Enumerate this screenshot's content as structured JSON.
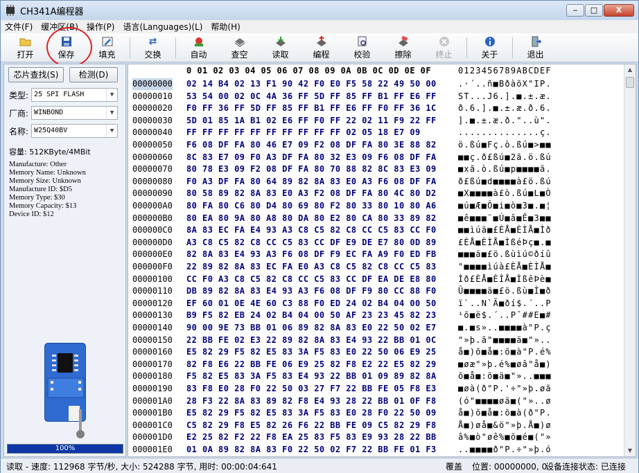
{
  "window": {
    "title": "CH341A编程器",
    "min_label": "‒",
    "max_label": "□",
    "close_label": "X"
  },
  "menu": [
    "文件(F)",
    "缓冲区(B)",
    "操作(P)",
    "语言(Languages)(L)",
    "帮助(H)"
  ],
  "toolbar": [
    {
      "label": "打开",
      "icon": "open-icon"
    },
    {
      "label": "保存",
      "icon": "save-icon"
    },
    {
      "label": "填充",
      "icon": "fill-icon"
    },
    {
      "label": "交换",
      "icon": "swap-icon"
    },
    {
      "label": "自动",
      "icon": "auto-icon"
    },
    {
      "label": "查空",
      "icon": "blank-check-icon"
    },
    {
      "label": "读取",
      "icon": "read-icon"
    },
    {
      "label": "编程",
      "icon": "program-icon"
    },
    {
      "label": "校验",
      "icon": "verify-icon"
    },
    {
      "label": "擦除",
      "icon": "erase-icon"
    },
    {
      "label": "终止",
      "icon": "stop-icon"
    },
    {
      "label": "关于",
      "icon": "about-icon"
    },
    {
      "label": "退出",
      "icon": "exit-icon"
    }
  ],
  "left": {
    "chip_find_btn": "芯片查找(S)",
    "detect_btn": "检测(D)",
    "type_label": "类型:",
    "type_value": "25 SPI FLASH",
    "vendor_label": "厂商:",
    "vendor_value": "WINBOND",
    "name_label": "名称:",
    "name_value": "W25Q40BV",
    "capacity": "容量: 512KByte/4MBit",
    "info_lines": [
      "Manufacture: Other",
      "Memory Name: Unknown",
      "Memory Size: Unknown",
      "Manufacture ID: $D5",
      "Memory Type: $30",
      "Memory Capacity: $13",
      "Device ID: $12"
    ],
    "progress_text": "100%",
    "progress_value": 1.0
  },
  "hex": {
    "header_cols": "0 01 02 03 04 05 06 07 08 09 0A 0B 0C 0D 0E 0F",
    "header_ascii": "0123456789ABCDEF",
    "rows": [
      {
        "addr": "00000000",
        "bytes": "02 14 B4 02 13 F1 90 42 F0 E0 F5 58 22 49 50 00",
        "ascii": ".·´..ñ■BðàõX\"IP."
      },
      {
        "addr": "00000010",
        "bytes": "53 54 00 02 0C 4A 36 FF 5D FF 85 FF B1 FF E6 FF",
        "ascii": "ST...J6.].■.±.æ."
      },
      {
        "addr": "00000020",
        "bytes": "F0 FF 36 FF 5D FF 85 FF B1 FF E6 FF F0 FF 36 1C",
        "ascii": "ð.6.].■.±.æ.ð.6."
      },
      {
        "addr": "00000030",
        "bytes": "5D 01 85 1A B1 02 E6 FF F0 FF 22 02 11 F9 22 FF",
        "ascii": "].■.±.æ.ð.\"..ù\"."
      },
      {
        "addr": "00000040",
        "bytes": "FF FF FF FF FF FF FF FF FF FF 02 05 18 E7 09",
        "ascii": "..............ç."
      },
      {
        "addr": "00000050",
        "bytes": "F6 08 DF FA 80 46 E7 09 F2 08 DF FA 80 3E 88 82",
        "ascii": "ö.ßú■Fç.ò.ßú■>■■"
      },
      {
        "addr": "00000060",
        "bytes": "8C 83 E7 09 F0 A3 DF FA 80 32 E3 09 F6 08 DF FA",
        "ascii": "■■ç.ð£ßú■2ã.ö.ßú"
      },
      {
        "addr": "00000070",
        "bytes": "80 78 E3 09 F2 08 DF FA 80 70 88 82 8C 83 E3 09",
        "ascii": "■xã.ò.ßú■p■■■■ã."
      },
      {
        "addr": "00000080",
        "bytes": "F0 A3 DF FA 80 64 89 82 8A 83 E0 A3 F6 08 DF FA",
        "ascii": "ð£ßú■d■■■■à£ö.ßú"
      },
      {
        "addr": "00000090",
        "bytes": "80 58 89 82 8A 83 E0 A3 F2 08 DF FA 80 4C 80 D2",
        "ascii": "■X■■■■à£ò.ßú■L■Ò"
      },
      {
        "addr": "000000A0",
        "bytes": "80 FA 80 C6 80 D4 80 69 80 F2 80 33 80 10 80 A6",
        "ascii": "■ú■Æ■Ô■i■ò■3■.■¦"
      },
      {
        "addr": "000000B0",
        "bytes": "80 EA 80 9A 80 A8 80 DA 80 E2 80 CA 80 33 89 82",
        "ascii": "■ê■■■¨■Ú■â■Ê■3■■"
      },
      {
        "addr": "000000C0",
        "bytes": "8A 83 EC FA E4 93 A3 C8 C5 82 C8 CC C5 83 CC F0",
        "ascii": "■■ìúä■£ÈÅ■ÈÌÅ■Ìð"
      },
      {
        "addr": "000000D0",
        "bytes": "A3 C8 C5 82 C8 CC C5 83 CC DF E9 DE E7 80 0D 89",
        "ascii": "£ÈÅ■ÈÌÅ■ÌßéÞç■.■"
      },
      {
        "addr": "000000E0",
        "bytes": "82 8A 83 E4 93 A3 F6 08 DF F9 EC FA A9 F0 ED FB",
        "ascii": "■■■ä■£ö.ßùìú©ðíû"
      },
      {
        "addr": "000000F0",
        "bytes": "22 89 82 8A 83 EC FA E0 A3 C8 C5 82 C8 CC C5 83",
        "ascii": "\"■■■■ìúà£ÈÅ■ÈÌÅ■"
      },
      {
        "addr": "00000100",
        "bytes": "CC F0 A3 C8 C5 82 C8 CC C5 83 CC DF EA DE E8 80",
        "ascii": "Ìð£ÈÅ■ÈÌÅ■ÌßêÞè■"
      },
      {
        "addr": "00000110",
        "bytes": "DB 89 82 8A 83 E4 93 A3 F6 08 DF F9 80 CC 88 F0",
        "ascii": "Û■■■■ä■£ö.ßù■Ì■ð"
      },
      {
        "addr": "00000120",
        "bytes": "EF 60 01 0E 4E 60 C3 88 F0 ED 24 02 B4 04 00 50",
        "ascii": "ï`..N`Ã■ðí$.´..P"
      },
      {
        "addr": "00000130",
        "bytes": "B9 F5 82 EB 24 02 B4 04 00 50 AF 23 23 45 82 23",
        "ascii": "¹õ■ë$.´..P¯##E■#"
      },
      {
        "addr": "00000140",
        "bytes": "90 00 9E 73 BB 01 06 89 82 8A 83 E0 22 50 02 E7",
        "ascii": "■.■s»..■■■■à\"P.ç"
      },
      {
        "addr": "00000150",
        "bytes": "22 BB FE 02 E3 22 89 82 8A 83 E4 93 22 BB 01 0C",
        "ascii": "\"»þ.ã\"■■■■ä■\"».."
      },
      {
        "addr": "00000160",
        "bytes": "E5 82 29 F5 82 E5 83 3A F5 83 E0 22 50 06 E9 25",
        "ascii": "å■)õ■å■:õ■à\"P.é%"
      },
      {
        "addr": "00000170",
        "bytes": "82 F8 E6 22 BB FE 06 E9 25 82 F8 E2 22 E5 82 29",
        "ascii": "■øæ\"»þ.é%■øâ\"å■)"
      },
      {
        "addr": "00000180",
        "bytes": "F5 82 E5 83 3A F5 83 E4 93 22 BB 01 09 89 82 8A",
        "ascii": "õ■å■:õ■ä■\"»..■■■"
      },
      {
        "addr": "00000190",
        "bytes": "83 F8 E0 28 F0 22 50 03 27 F7 22 BB FE 05 F8 E3",
        "ascii": "■øà(ð\"P.'÷\"»þ.øã"
      },
      {
        "addr": "000001A0",
        "bytes": "28 F3 22 8A 83 89 82 F8 E4 93 28 22 BB 01 0F F8",
        "ascii": "(ó\"■■■■øä■(\"»..ø"
      },
      {
        "addr": "000001B0",
        "bytes": "E5 82 29 F5 82 E5 83 3A F5 83 E0 28 F0 22 50 09",
        "ascii": "å■)õ■å■:õ■à(ð\"P."
      },
      {
        "addr": "000001C0",
        "bytes": "C5 82 29 F8 E5 82 26 F6 22 BB FE 09 C5 82 29 F8",
        "ascii": "Å■)øå■&ö\"»þ.Å■)ø"
      },
      {
        "addr": "000001D0",
        "bytes": "E2 25 82 F2 22 F8 EA 25 83 F5 83 E9 93 28 22 BB",
        "ascii": "â%■ò\"øê%■õ■é■(\"»"
      },
      {
        "addr": "000001E0",
        "bytes": "01 0A 89 82 8A 83 F0 22 50 02 F7 22 BB FE 01 F3",
        "ascii": "..■■■■ð\"P.÷\"»þ.ó"
      }
    ]
  },
  "status": {
    "left": "读取 - 速度: 112968 字节/秒, 大小: 524288 字节, 用时: 00:00:04:641",
    "mode": "覆盖",
    "position": "位置: 00000000, 0",
    "conn": "设备连接状态: 已连接"
  }
}
